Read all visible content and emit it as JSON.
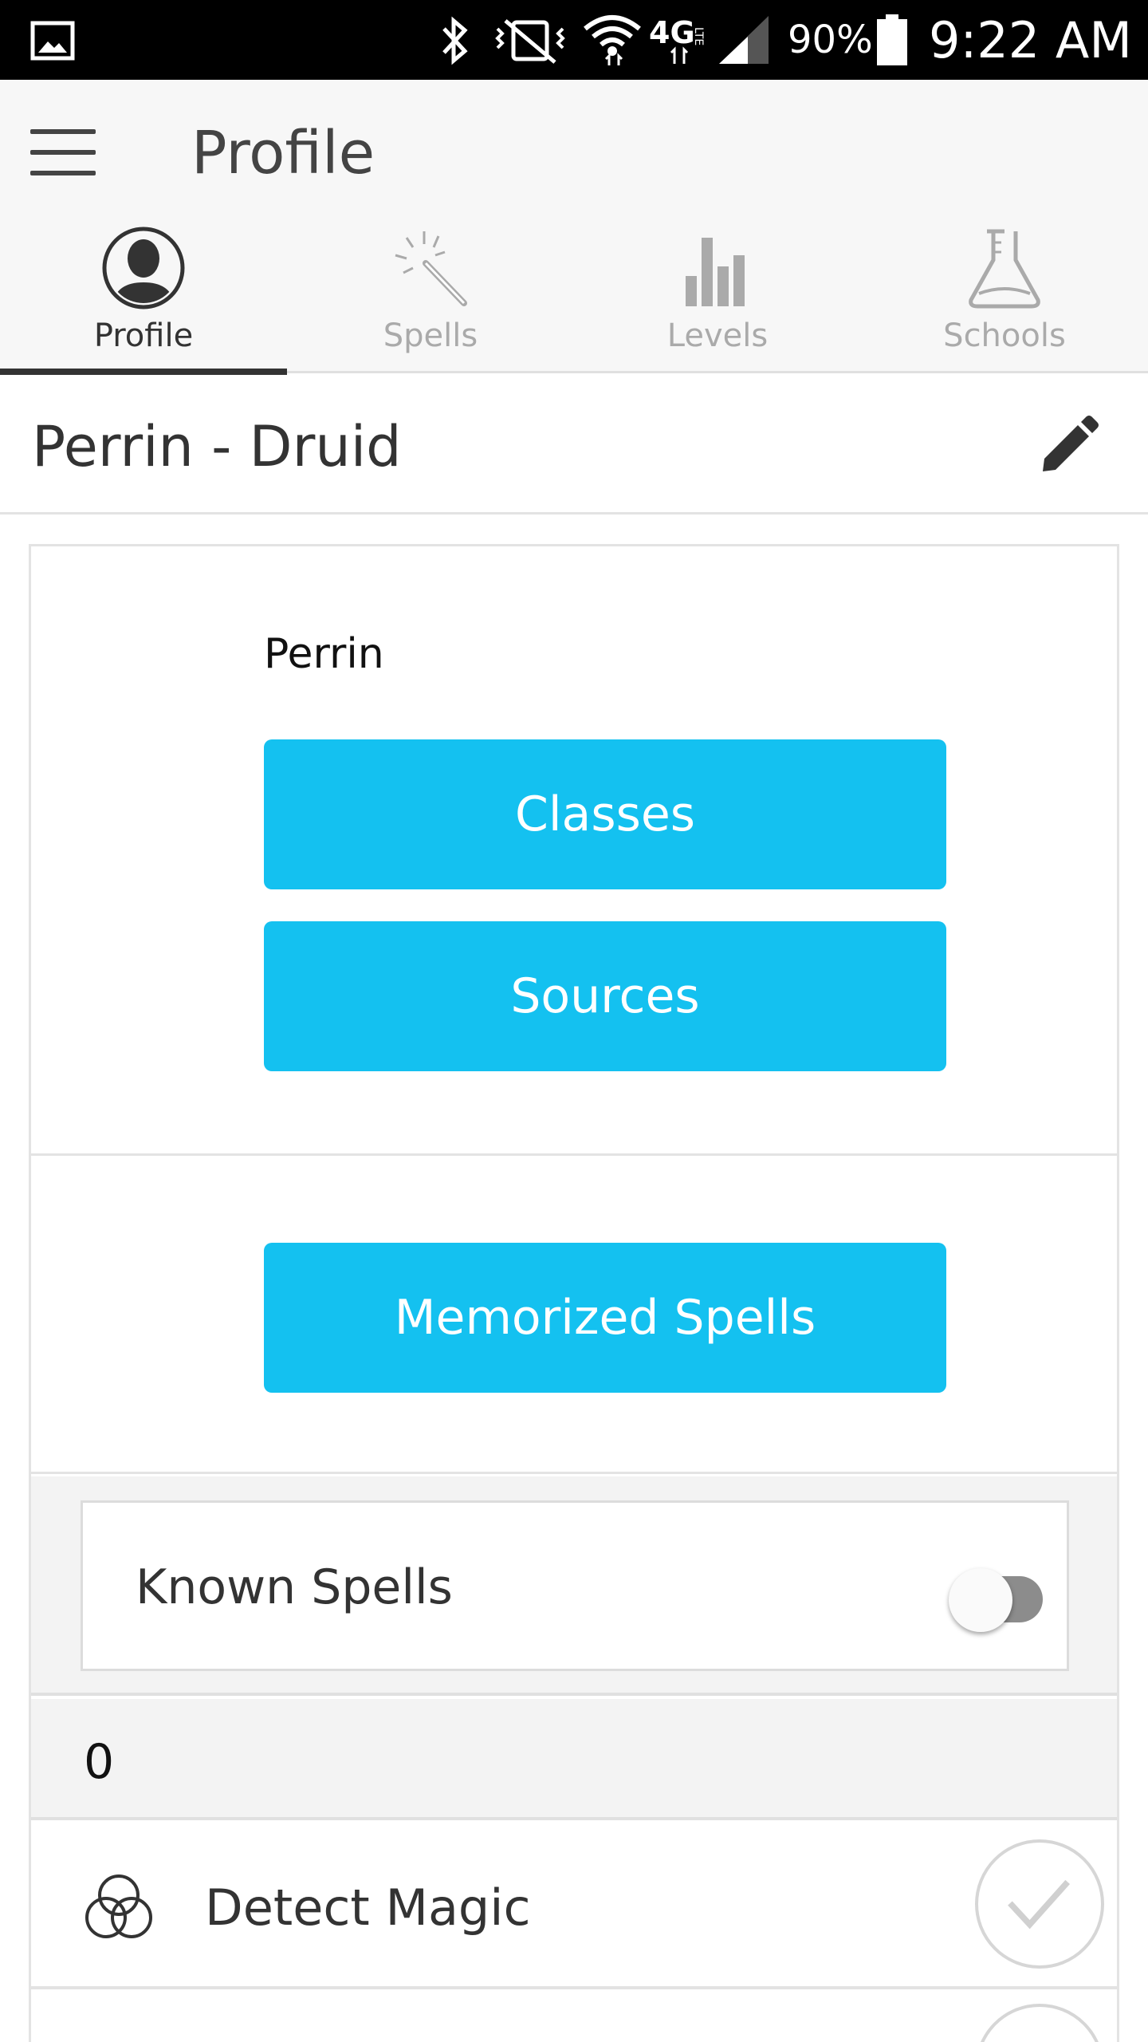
{
  "status_bar": {
    "battery_percent": "90%",
    "time": "9:22 AM",
    "icons": [
      "gallery-icon",
      "bluetooth-icon",
      "vibrate-mute-icon",
      "wifi-icon",
      "4g-lte-icon",
      "signal-icon",
      "battery-icon"
    ]
  },
  "app_bar": {
    "title": "Profile",
    "menu_icon": "hamburger-menu-icon"
  },
  "tabs": [
    {
      "label": "Profile",
      "icon": "user-avatar-icon",
      "active": true
    },
    {
      "label": "Spells",
      "icon": "magic-wand-icon",
      "active": false
    },
    {
      "label": "Levels",
      "icon": "bar-chart-icon",
      "active": false
    },
    {
      "label": "Schools",
      "icon": "flask-icon",
      "active": false
    }
  ],
  "page": {
    "title": "Perrin - Druid",
    "edit_icon": "pencil-icon"
  },
  "character": {
    "name": "Perrin",
    "classes_label": "Classes",
    "sources_label": "Sources",
    "memorized_label": "Memorized Spells"
  },
  "known_spells": {
    "label": "Known Spells",
    "toggle_on": false
  },
  "spell_level": {
    "level": "0"
  },
  "spells": [
    {
      "name": "Detect Magic",
      "icon": "three-circles-icon",
      "check_icon": "checkmark-icon"
    }
  ],
  "colors": {
    "accent": "#14c1f0",
    "status_bar": "#000000",
    "app_bar": "#f7f7f7",
    "active_tab_indicator": "#333333"
  }
}
